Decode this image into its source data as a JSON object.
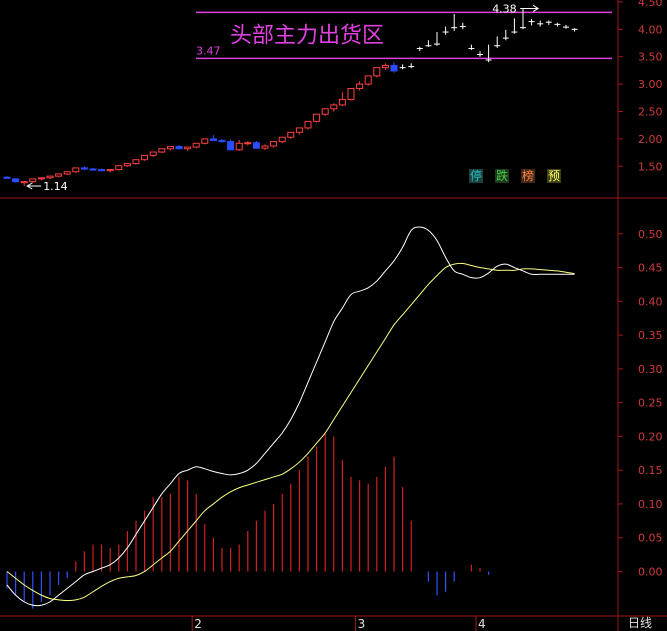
{
  "colors": {
    "background": "#000000",
    "axis": "#a01818",
    "tick_text": "#cf3b3b",
    "up_candle": "#ff4040",
    "down_candle": "#2a4dff",
    "flat_candle": "#ffffff",
    "zone": "#e040e0",
    "dif": "#ffffff",
    "dea": "#ffff80",
    "hist_pos": "#d02020",
    "hist_neg": "#3050ff"
  },
  "price_panel": {
    "yticks": [
      "1.50",
      "2.00",
      "2.50",
      "3.00",
      "3.50",
      "4.00",
      "4.50"
    ],
    "ylim": [
      1.14,
      4.48
    ],
    "zone": {
      "title": "头部主力出货区",
      "low": 3.47,
      "high": 4.31,
      "low_label": "3.47"
    },
    "low_marker": {
      "text": "1.14",
      "index": 2,
      "value": 1.14
    },
    "high_marker": {
      "text": "4.38",
      "index": 62,
      "value": 4.38
    },
    "signals": [
      {
        "text": "停",
        "color": "#20c0c0",
        "bg": "#204040"
      },
      {
        "text": "跌",
        "color": "#40d040",
        "bg": "#203820"
      },
      {
        "text": "榜",
        "color": "#ff8040",
        "bg": "#402818"
      },
      {
        "text": "预",
        "color": "#ffff60",
        "bg": "#404018"
      }
    ]
  },
  "macd_panel": {
    "yticks": [
      "0.00",
      "0.05",
      "0.10",
      "0.15",
      "0.20",
      "0.25",
      "0.30",
      "0.35",
      "0.40",
      "0.45",
      "0.50"
    ],
    "ylim": [
      -0.06,
      0.55
    ]
  },
  "period_labels": [
    {
      "text": "2",
      "index": 22
    },
    {
      "text": "3",
      "index": 41
    },
    {
      "text": "4",
      "index": 55
    }
  ],
  "bottom_right_label": "日线",
  "chart_data": [
    {
      "type": "candlestick",
      "open": [
        1.3,
        1.27,
        1.2,
        1.22,
        1.27,
        1.29,
        1.32,
        1.36,
        1.4,
        1.47,
        1.45,
        1.44,
        1.42,
        1.44,
        1.51,
        1.55,
        1.62,
        1.7,
        1.76,
        1.82,
        1.86,
        1.82,
        1.85,
        1.92,
        2.0,
        1.97,
        1.95,
        1.8,
        1.92,
        1.93,
        1.83,
        1.87,
        1.95,
        2.03,
        2.12,
        2.2,
        2.32,
        2.45,
        2.55,
        2.62,
        2.72,
        2.92,
        3.0,
        3.15,
        3.3,
        3.34,
        3.3,
        3.32,
        3.65,
        3.7,
        3.73,
        3.95,
        4.03,
        4.05,
        3.65,
        3.54,
        3.44,
        3.7,
        3.84,
        3.95,
        4.03,
        4.14,
        4.1,
        4.13,
        4.09,
        4.04,
        4.0
      ],
      "high": [
        1.32,
        1.28,
        1.23,
        1.25,
        1.29,
        1.31,
        1.34,
        1.38,
        1.43,
        1.5,
        1.47,
        1.46,
        1.44,
        1.47,
        1.54,
        1.58,
        1.65,
        1.73,
        1.79,
        1.86,
        1.89,
        1.85,
        1.92,
        1.99,
        2.07,
        2.0,
        1.99,
        1.98,
        1.96,
        1.96,
        1.9,
        1.94,
        2.0,
        2.09,
        2.18,
        2.26,
        2.4,
        2.55,
        2.65,
        2.85,
        2.92,
        3.05,
        3.15,
        3.3,
        3.38,
        3.4,
        3.36,
        3.38,
        3.68,
        3.8,
        3.95,
        4.05,
        4.28,
        4.12,
        3.72,
        3.6,
        3.72,
        3.87,
        3.99,
        4.2,
        4.38,
        4.19,
        4.16,
        4.16,
        4.12,
        4.08,
        4.02
      ],
      "low": [
        1.27,
        1.2,
        1.14,
        1.19,
        1.24,
        1.27,
        1.3,
        1.34,
        1.38,
        1.43,
        1.42,
        1.41,
        1.39,
        1.42,
        1.49,
        1.53,
        1.6,
        1.67,
        1.74,
        1.79,
        1.81,
        1.78,
        1.83,
        1.9,
        1.96,
        1.93,
        1.91,
        1.78,
        1.88,
        1.89,
        1.8,
        1.84,
        1.92,
        2.0,
        2.08,
        2.17,
        2.3,
        2.42,
        2.5,
        2.6,
        2.7,
        2.88,
        2.97,
        3.12,
        3.26,
        3.21,
        3.27,
        3.29,
        3.6,
        3.68,
        3.7,
        3.9,
        3.97,
        4.0,
        3.62,
        3.5,
        3.4,
        3.66,
        3.8,
        3.92,
        4.0,
        4.07,
        4.05,
        4.08,
        4.05,
        4.01,
        3.96
      ],
      "close": [
        1.28,
        1.22,
        1.22,
        1.27,
        1.29,
        1.32,
        1.36,
        1.4,
        1.47,
        1.45,
        1.44,
        1.42,
        1.44,
        1.51,
        1.55,
        1.62,
        1.7,
        1.76,
        1.82,
        1.86,
        1.82,
        1.85,
        1.92,
        2.0,
        1.97,
        1.95,
        1.8,
        1.92,
        1.93,
        1.83,
        1.87,
        1.95,
        2.03,
        2.12,
        2.2,
        2.32,
        2.45,
        2.55,
        2.62,
        2.72,
        2.92,
        3.0,
        3.15,
        3.3,
        3.34,
        3.24,
        3.3,
        3.32,
        3.65,
        3.7,
        3.73,
        3.95,
        4.03,
        4.05,
        3.65,
        3.54,
        3.44,
        3.7,
        3.84,
        3.95,
        4.03,
        4.14,
        4.1,
        4.13,
        4.09,
        4.04,
        4.0
      ]
    },
    {
      "type": "line",
      "series": [
        {
          "values": [
            -0.02,
            -0.035,
            -0.045,
            -0.05,
            -0.05,
            -0.045,
            -0.035,
            -0.025,
            -0.015,
            -0.005,
            0.0,
            0.005,
            0.01,
            0.02,
            0.035,
            0.055,
            0.075,
            0.095,
            0.115,
            0.13,
            0.145,
            0.15,
            0.155,
            0.152,
            0.148,
            0.145,
            0.143,
            0.145,
            0.15,
            0.16,
            0.175,
            0.19,
            0.205,
            0.225,
            0.25,
            0.28,
            0.31,
            0.34,
            0.37,
            0.39,
            0.41,
            0.415,
            0.42,
            0.43,
            0.445,
            0.46,
            0.48,
            0.505,
            0.51,
            0.505,
            0.49,
            0.465,
            0.445,
            0.44,
            0.435,
            0.435,
            0.442,
            0.452,
            0.455,
            0.45,
            0.445,
            0.44,
            0.44,
            0.44,
            0.44,
            0.44,
            0.44
          ]
        },
        {
          "values": [
            0.0,
            -0.01,
            -0.02,
            -0.028,
            -0.035,
            -0.04,
            -0.042,
            -0.043,
            -0.042,
            -0.038,
            -0.03,
            -0.022,
            -0.015,
            -0.01,
            -0.008,
            -0.006,
            0.0,
            0.01,
            0.02,
            0.03,
            0.045,
            0.06,
            0.075,
            0.09,
            0.1,
            0.11,
            0.118,
            0.124,
            0.128,
            0.132,
            0.136,
            0.14,
            0.144,
            0.152,
            0.162,
            0.175,
            0.19,
            0.205,
            0.225,
            0.245,
            0.265,
            0.285,
            0.305,
            0.325,
            0.345,
            0.365,
            0.38,
            0.395,
            0.41,
            0.425,
            0.438,
            0.45,
            0.455,
            0.456,
            0.453,
            0.45,
            0.448,
            0.446,
            0.446,
            0.446,
            0.448,
            0.448,
            0.447,
            0.446,
            0.445,
            0.443,
            0.441
          ]
        }
      ],
      "histogram": [
        -0.025,
        -0.035,
        -0.045,
        -0.055,
        -0.045,
        -0.035,
        -0.02,
        -0.01,
        0.015,
        0.03,
        0.04,
        0.04,
        0.035,
        0.04,
        0.06,
        0.075,
        0.09,
        0.11,
        0.11,
        0.115,
        0.14,
        0.135,
        0.115,
        0.07,
        0.05,
        0.035,
        0.035,
        0.04,
        0.06,
        0.075,
        0.09,
        0.1,
        0.115,
        0.13,
        0.15,
        0.17,
        0.185,
        0.205,
        0.2,
        0.165,
        0.14,
        0.135,
        0.13,
        0.14,
        0.155,
        0.17,
        0.125,
        0.075,
        0.0,
        -0.015,
        -0.035,
        -0.03,
        -0.015,
        0.0,
        0.01,
        0.005,
        -0.005,
        0.0,
        0.0,
        0.0,
        0.0,
        0.0,
        0.0,
        0.0,
        0.0,
        0.0,
        0.0
      ]
    }
  ]
}
